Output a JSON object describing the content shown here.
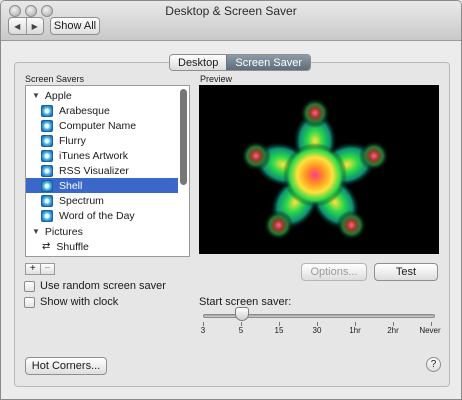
{
  "window": {
    "title": "Desktop & Screen Saver"
  },
  "toolbar": {
    "back_icon": "back-arrow-icon",
    "forward_icon": "forward-arrow-icon",
    "show_all": "Show All"
  },
  "tabs": [
    {
      "label": "Desktop",
      "active": false
    },
    {
      "label": "Screen Saver",
      "active": true
    }
  ],
  "screen_savers": {
    "label": "Screen Savers",
    "groups": [
      {
        "name": "Apple",
        "items": [
          "Arabesque",
          "Computer Name",
          "Flurry",
          "iTunes Artwork",
          "RSS Visualizer",
          "Shell",
          "Spectrum",
          "Word of the Day"
        ]
      },
      {
        "name": "Pictures",
        "items": [
          "Shuffle"
        ]
      }
    ],
    "selected": "Shell",
    "add_label": "+",
    "remove_label": "−"
  },
  "preview": {
    "label": "Preview"
  },
  "buttons": {
    "options": "Options...",
    "test": "Test",
    "hot_corners": "Hot Corners...",
    "help": "?"
  },
  "checkboxes": [
    {
      "label": "Use random screen saver",
      "checked": false
    },
    {
      "label": "Show with clock",
      "checked": false
    }
  ],
  "start": {
    "label": "Start screen saver:",
    "ticks": [
      "3",
      "5",
      "15",
      "30",
      "1hr",
      "2hr",
      "Never"
    ],
    "value": "5"
  }
}
